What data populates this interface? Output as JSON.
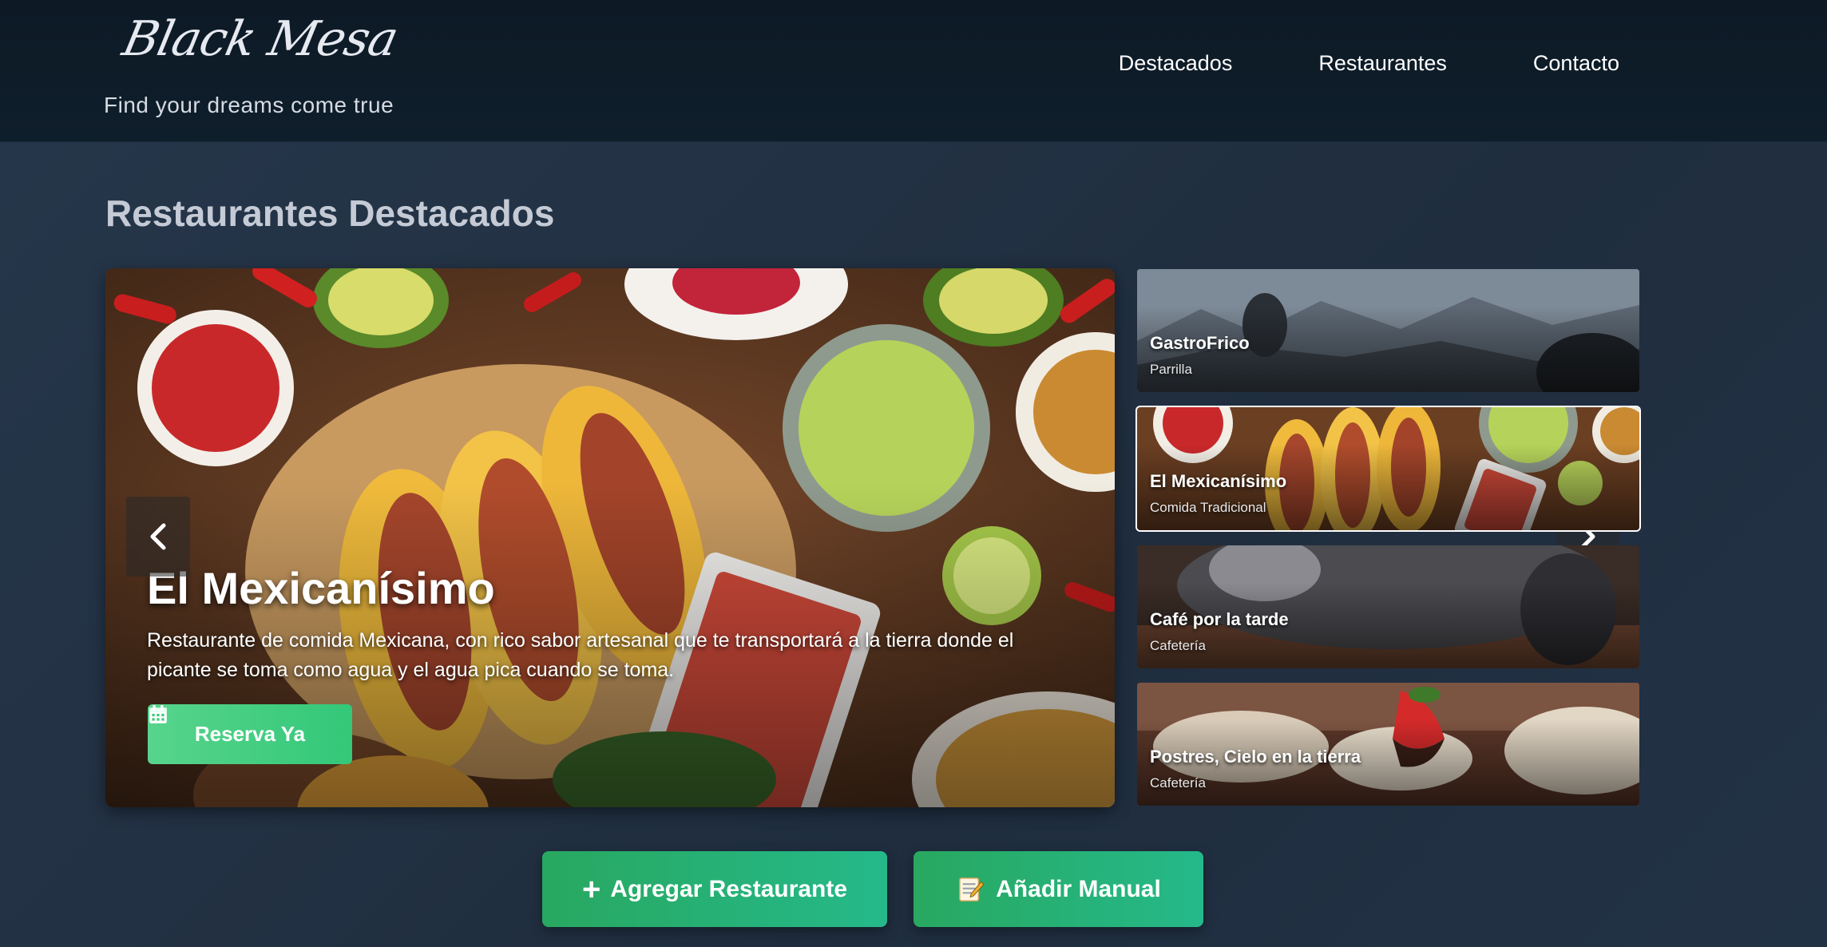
{
  "brand": {
    "logo_text": "Black Mesa",
    "tagline": "Find your dreams come true"
  },
  "nav": {
    "items": [
      {
        "label": "Destacados"
      },
      {
        "label": "Restaurantes"
      },
      {
        "label": "Contacto"
      }
    ]
  },
  "section": {
    "title": "Restaurantes Destacados"
  },
  "featured": {
    "name": "El Mexicanísimo",
    "description": "Restaurante de comida Mexicana, con rico sabor artesanal que te transportará a la tierra donde el picante se toma como agua y el agua pica cuando se toma.",
    "reserve_label": "Reserva Ya",
    "reserve_icon": "calendar-icon"
  },
  "thumbnails": [
    {
      "title": "GastroFrico",
      "subtitle": "Parrilla",
      "active": false
    },
    {
      "title": "El Mexicanísimo",
      "subtitle": "Comida Tradicional",
      "active": true
    },
    {
      "title": "Café por la tarde",
      "subtitle": "Cafetería",
      "active": false
    },
    {
      "title": "Postres, Cielo en la tierra",
      "subtitle": "Cafetería",
      "active": false
    }
  ],
  "actions": {
    "add_label": "Agregar Restaurante",
    "add_icon": "plus-icon",
    "manual_label": "Añadir Manual",
    "manual_icon": "memo-icon"
  },
  "colors": {
    "header_bg": "#0f1e2b",
    "page_bg": "#223042",
    "accent_green": "#2fb872"
  }
}
